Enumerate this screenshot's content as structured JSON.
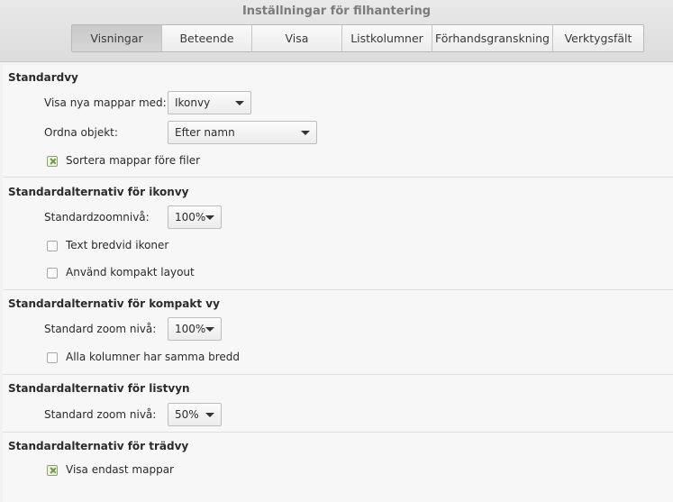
{
  "window": {
    "title": "Inställningar för filhantering"
  },
  "tabs": [
    {
      "label": "Visningar",
      "active": true
    },
    {
      "label": "Beteende",
      "active": false
    },
    {
      "label": "Visa",
      "active": false
    },
    {
      "label": "Listkolumner",
      "active": false
    },
    {
      "label": "Förhandsgranskning",
      "active": false
    },
    {
      "label": "Verktygsfält",
      "active": false
    }
  ],
  "sections": {
    "default_view": {
      "title": "Standardvy",
      "view_new_folders_label": "Visa nya mappar med:",
      "view_new_folders_value": "Ikonvy",
      "arrange_label": "Ordna objekt:",
      "arrange_value": "Efter namn",
      "sort_folders_label": "Sortera mappar före filer",
      "sort_folders_checked": true
    },
    "icon_view": {
      "title": "Standardalternativ för ikonvy",
      "zoom_label": "Standardzoomnivå:",
      "zoom_value": "100%",
      "text_beside_label": "Text bredvid ikoner",
      "text_beside_checked": false,
      "compact_layout_label": "Använd kompakt layout",
      "compact_layout_checked": false
    },
    "compact_view": {
      "title": "Standardalternativ för kompakt vy",
      "zoom_label": "Standard zoom nivå:",
      "zoom_value": "100%",
      "same_width_label": "Alla kolumner har samma bredd",
      "same_width_checked": false
    },
    "list_view": {
      "title": "Standardalternativ för listvyn",
      "zoom_label": "Standard zoom nivå:",
      "zoom_value": "50%"
    },
    "tree_view": {
      "title": "Standardalternativ för trädvy",
      "only_folders_label": "Visa endast mappar",
      "only_folders_checked": true
    }
  },
  "colors": {
    "accent_check": "#6a9a42"
  }
}
